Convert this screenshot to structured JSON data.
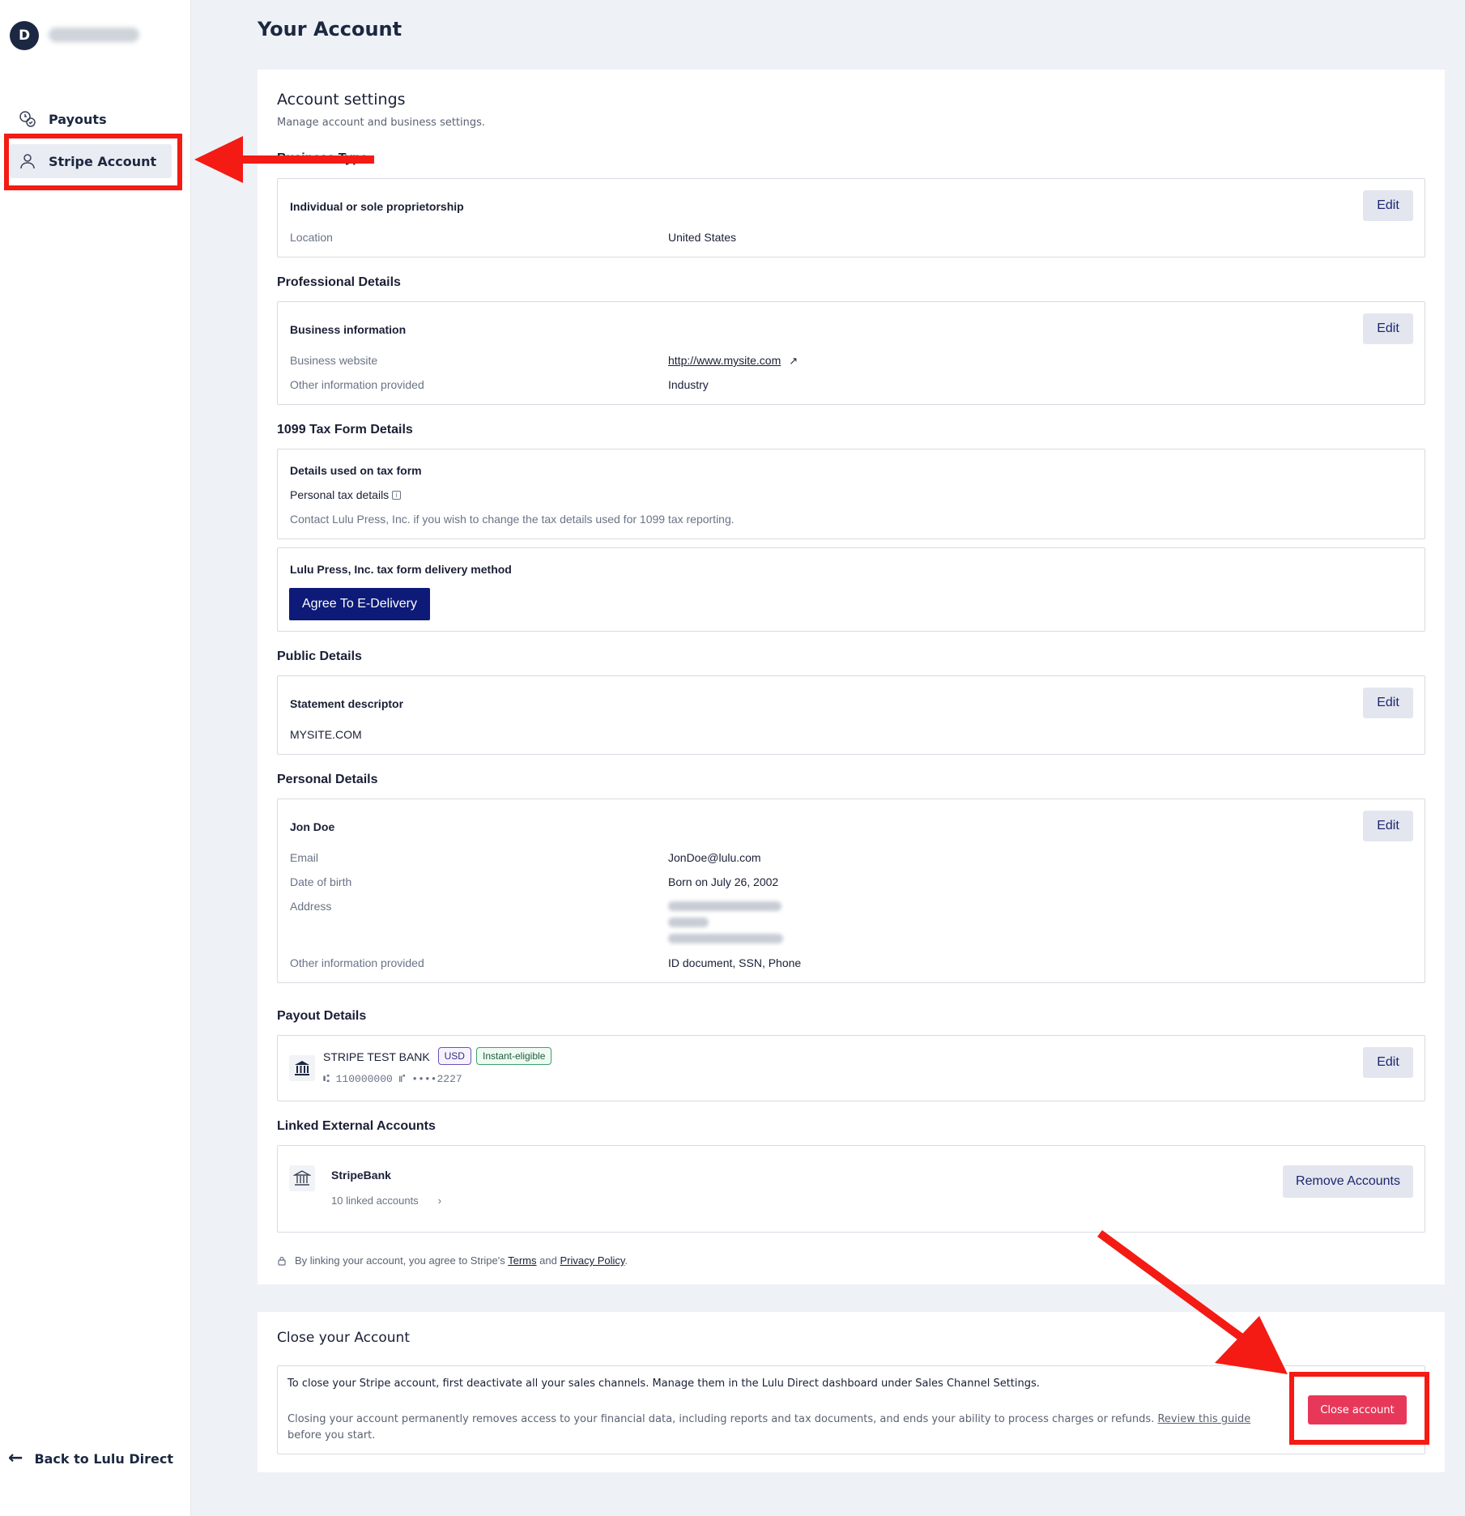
{
  "sidebar": {
    "avatar_initial": "D",
    "nav": [
      {
        "label": "Payouts",
        "icon": "payouts-icon"
      },
      {
        "label": "Stripe Account",
        "icon": "person-icon"
      }
    ],
    "back_label": "Back to Lulu Direct"
  },
  "page": {
    "title": "Your Account"
  },
  "settings": {
    "title": "Account settings",
    "subtitle": "Manage account and business settings.",
    "business_type": {
      "section": "Business Type",
      "card_title": "Individual or sole proprietorship",
      "location_label": "Location",
      "location_value": "United States",
      "edit": "Edit"
    },
    "professional": {
      "section": "Professional Details",
      "card_title": "Business information",
      "website_label": "Business website",
      "website_value": "http://www.mysite.com",
      "other_label": "Other information provided",
      "other_value": "Industry",
      "edit": "Edit"
    },
    "tax": {
      "section": "1099 Tax Form Details",
      "card_title": "Details used on tax form",
      "personal_label": "Personal tax details",
      "contact_text": "Contact Lulu Press, Inc. if you wish to change the tax details used for 1099 tax reporting.",
      "delivery_title": "Lulu Press, Inc. tax form delivery method",
      "delivery_button": "Agree To E-Delivery"
    },
    "public": {
      "section": "Public Details",
      "card_title": "Statement descriptor",
      "descriptor_value": "MYSITE.COM",
      "edit": "Edit"
    },
    "personal": {
      "section": "Personal Details",
      "card_title": "Jon Doe",
      "email_label": "Email",
      "email_value": "JonDoe@lulu.com",
      "dob_label": "Date of birth",
      "dob_value": "Born on July 26, 2002",
      "address_label": "Address",
      "other_label": "Other information provided",
      "other_value": "ID document, SSN, Phone",
      "edit": "Edit"
    },
    "payout": {
      "section": "Payout Details",
      "bank_name": "STRIPE TEST BANK",
      "badge_currency": "USD",
      "badge_instant": "Instant-eligible",
      "routing": "110000000",
      "account": "••••2227",
      "edit": "Edit"
    },
    "linked": {
      "section": "Linked External Accounts",
      "bank_name": "StripeBank",
      "count_text": "10 linked accounts",
      "remove_button": "Remove Accounts"
    },
    "legal": {
      "prefix": "By linking your account, you agree to Stripe's",
      "terms": "Terms",
      "and": "and",
      "privacy": "Privacy Policy",
      "suffix": "."
    }
  },
  "close": {
    "title": "Close your Account",
    "p1": "To close your Stripe account, first deactivate all your sales channels. Manage them in the Lulu Direct dashboard under Sales Channel Settings.",
    "p2_prefix": "Closing your account permanently removes access to your financial data, including reports and tax documents, and ends your ability to process charges or refunds.",
    "p2_link": "Review this guide",
    "p2_suffix": "before you start.",
    "button": "Close account"
  },
  "colors": {
    "annotation_red": "#f31b14",
    "primary_navy": "#0d1a78",
    "danger_pink": "#e8385a",
    "secondary_btn_bg": "#e3e6ee"
  }
}
